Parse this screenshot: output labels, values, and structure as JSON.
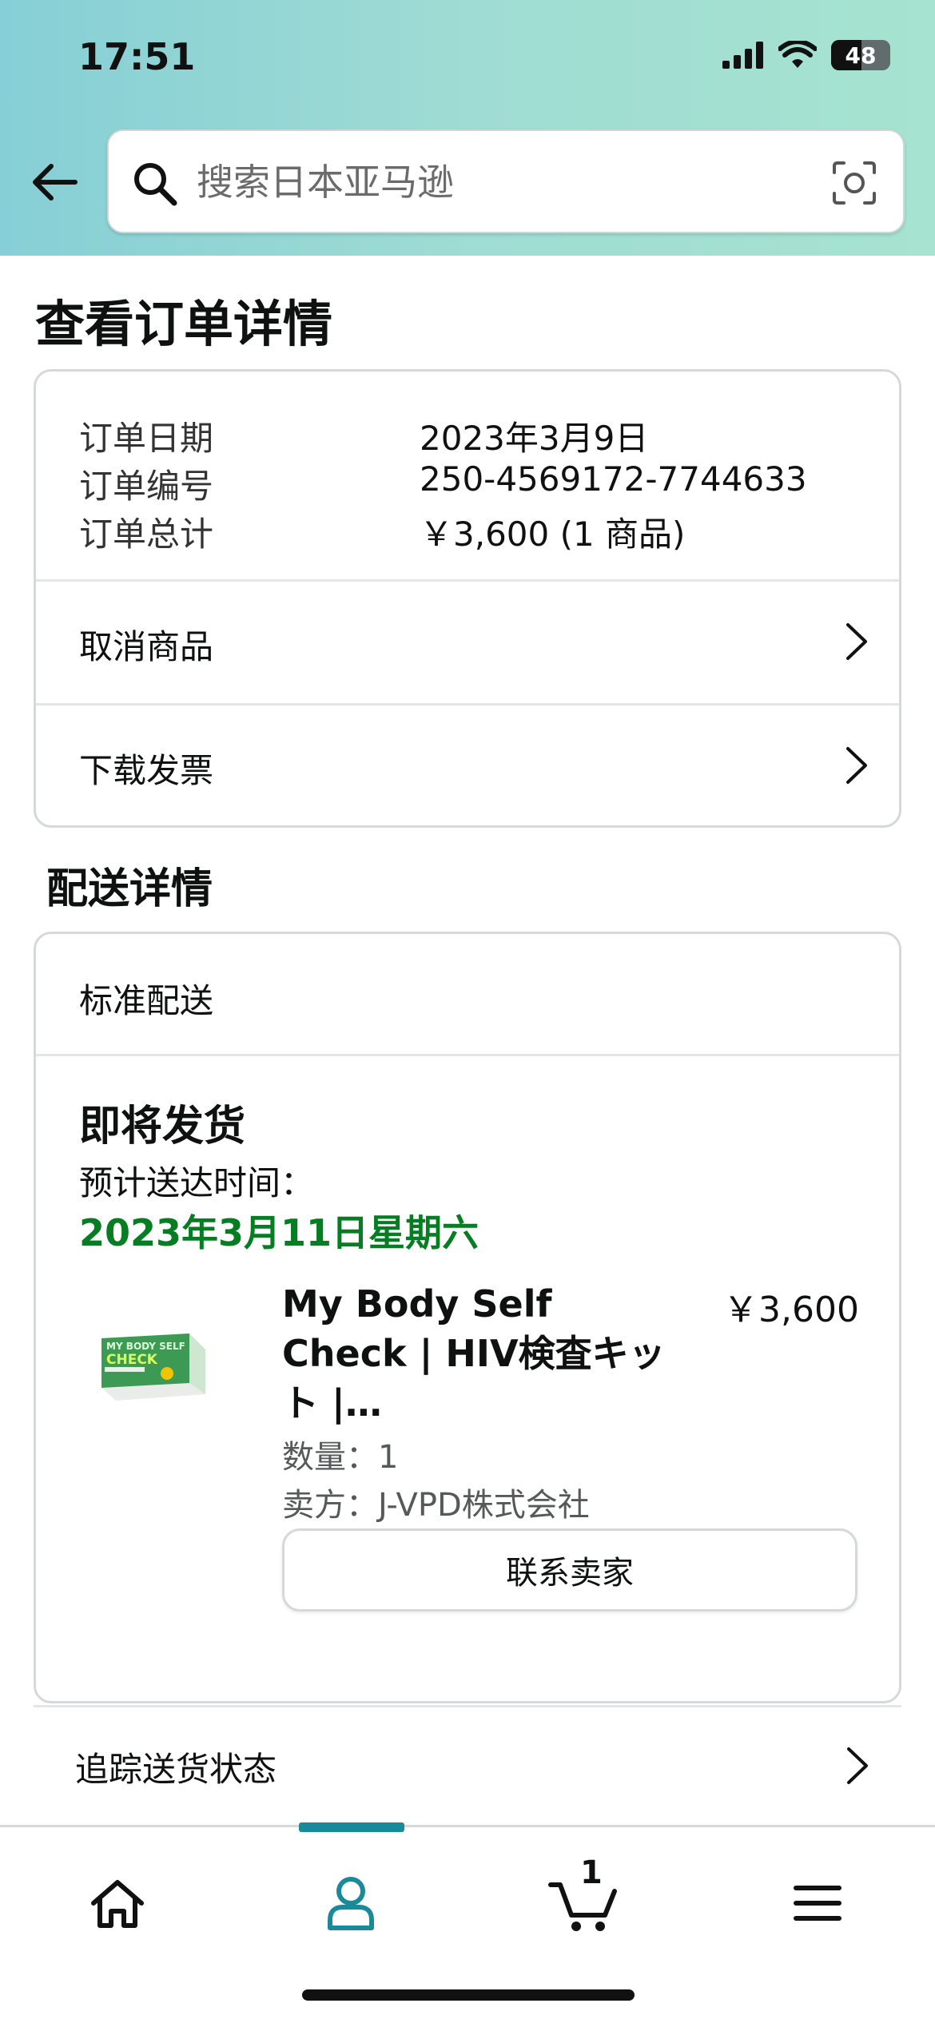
{
  "status_bar": {
    "time": "17:51",
    "battery": "48"
  },
  "search": {
    "placeholder": "搜索日本亚马逊"
  },
  "page": {
    "title": "查看订单详情"
  },
  "order_summary": {
    "rows": [
      {
        "label": "订单日期",
        "value": "2023年3月9日"
      },
      {
        "label": "订单编号",
        "value": "250-4569172-7744633"
      },
      {
        "label": "订单总计",
        "value": "￥3,600 (1 商品)"
      }
    ],
    "links": [
      {
        "label": "取消商品"
      },
      {
        "label": "下载发票"
      }
    ]
  },
  "delivery": {
    "section_title": "配送详情",
    "method": "标准配送",
    "status_title": "即将发货",
    "eta_label": "预计送达时间：",
    "eta_date": "2023年3月11日星期六",
    "item": {
      "name": "My Body Self Check | HIV検査キット |…",
      "price": "￥3,600",
      "quantity": "数量：1",
      "seller": "卖方：J-VPD株式会社",
      "contact_label": "联系卖家",
      "thumb_text": {
        "line1": "MY BODY SELF",
        "line2": "CHECK"
      }
    }
  },
  "track": {
    "label": "追踪送货状态"
  },
  "tabbar": {
    "cart_count": "1",
    "tabs": [
      "home-icon",
      "account-icon",
      "cart-icon",
      "menu-icon"
    ],
    "accent_color": "#1a8a9a"
  },
  "colors": {
    "eta": "#067d22",
    "header_start": "#86cfd6",
    "header_end": "#a6e3d0"
  }
}
